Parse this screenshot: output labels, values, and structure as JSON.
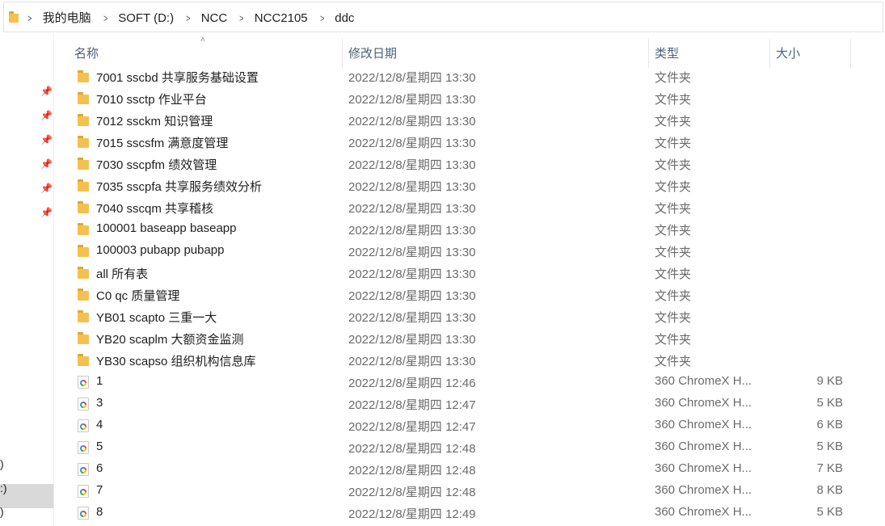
{
  "breadcrumb": [
    "我的电脑",
    "SOFT (D:)",
    "NCC",
    "NCC2105",
    "ddc"
  ],
  "nav": {
    "items": [
      ")",
      ":)",
      ")"
    ]
  },
  "columns": {
    "name": "名称",
    "date": "修改日期",
    "type": "类型",
    "size": "大小"
  },
  "files": [
    {
      "kind": "folder",
      "name": "7001 sscbd 共享服务基础设置",
      "date": "2022/12/8/星期四 13:30",
      "type": "文件夹",
      "size": ""
    },
    {
      "kind": "folder",
      "name": "7010 ssctp 作业平台",
      "date": "2022/12/8/星期四 13:30",
      "type": "文件夹",
      "size": ""
    },
    {
      "kind": "folder",
      "name": "7012 ssckm 知识管理",
      "date": "2022/12/8/星期四 13:30",
      "type": "文件夹",
      "size": ""
    },
    {
      "kind": "folder",
      "name": "7015 sscsfm 满意度管理",
      "date": "2022/12/8/星期四 13:30",
      "type": "文件夹",
      "size": ""
    },
    {
      "kind": "folder",
      "name": "7030 sscpfm 绩效管理",
      "date": "2022/12/8/星期四 13:30",
      "type": "文件夹",
      "size": ""
    },
    {
      "kind": "folder",
      "name": "7035 sscpfa 共享服务绩效分析",
      "date": "2022/12/8/星期四 13:30",
      "type": "文件夹",
      "size": ""
    },
    {
      "kind": "folder",
      "name": "7040 sscqm 共享稽核",
      "date": "2022/12/8/星期四 13:30",
      "type": "文件夹",
      "size": ""
    },
    {
      "kind": "folder",
      "name": "100001 baseapp baseapp",
      "date": "2022/12/8/星期四 13:30",
      "type": "文件夹",
      "size": ""
    },
    {
      "kind": "folder",
      "name": "100003 pubapp pubapp",
      "date": "2022/12/8/星期四 13:30",
      "type": "文件夹",
      "size": ""
    },
    {
      "kind": "folder",
      "name": "all  所有表",
      "date": "2022/12/8/星期四 13:30",
      "type": "文件夹",
      "size": ""
    },
    {
      "kind": "folder",
      "name": "C0 qc 质量管理",
      "date": "2022/12/8/星期四 13:30",
      "type": "文件夹",
      "size": ""
    },
    {
      "kind": "folder",
      "name": "YB01 scapto 三重一大",
      "date": "2022/12/8/星期四 13:30",
      "type": "文件夹",
      "size": ""
    },
    {
      "kind": "folder",
      "name": "YB20 scaplm 大额资金监测",
      "date": "2022/12/8/星期四 13:30",
      "type": "文件夹",
      "size": ""
    },
    {
      "kind": "folder",
      "name": "YB30 scapso 组织机构信息库",
      "date": "2022/12/8/星期四 13:30",
      "type": "文件夹",
      "size": ""
    },
    {
      "kind": "file",
      "name": "1",
      "date": "2022/12/8/星期四 12:46",
      "type": "360 ChromeX H...",
      "size": "9 KB"
    },
    {
      "kind": "file",
      "name": "3",
      "date": "2022/12/8/星期四 12:47",
      "type": "360 ChromeX H...",
      "size": "5 KB"
    },
    {
      "kind": "file",
      "name": "4",
      "date": "2022/12/8/星期四 12:47",
      "type": "360 ChromeX H...",
      "size": "6 KB"
    },
    {
      "kind": "file",
      "name": "5",
      "date": "2022/12/8/星期四 12:48",
      "type": "360 ChromeX H...",
      "size": "5 KB"
    },
    {
      "kind": "file",
      "name": "6",
      "date": "2022/12/8/星期四 12:48",
      "type": "360 ChromeX H...",
      "size": "7 KB"
    },
    {
      "kind": "file",
      "name": "7",
      "date": "2022/12/8/星期四 12:48",
      "type": "360 ChromeX H...",
      "size": "8 KB"
    },
    {
      "kind": "file",
      "name": "8",
      "date": "2022/12/8/星期四 12:49",
      "type": "360 ChromeX H...",
      "size": "5 KB"
    }
  ],
  "icons": {
    "folder": "folder-icon",
    "file": "chromex-html-file-icon",
    "pin": "pin-icon",
    "sort": "sort-up-icon",
    "separator": "chevron-right-icon"
  },
  "colors": {
    "folder": "#f4c150",
    "header_text": "#4c607a",
    "secondary_text": "#6b6b6b",
    "nav_selected": "#d9d9d9"
  }
}
